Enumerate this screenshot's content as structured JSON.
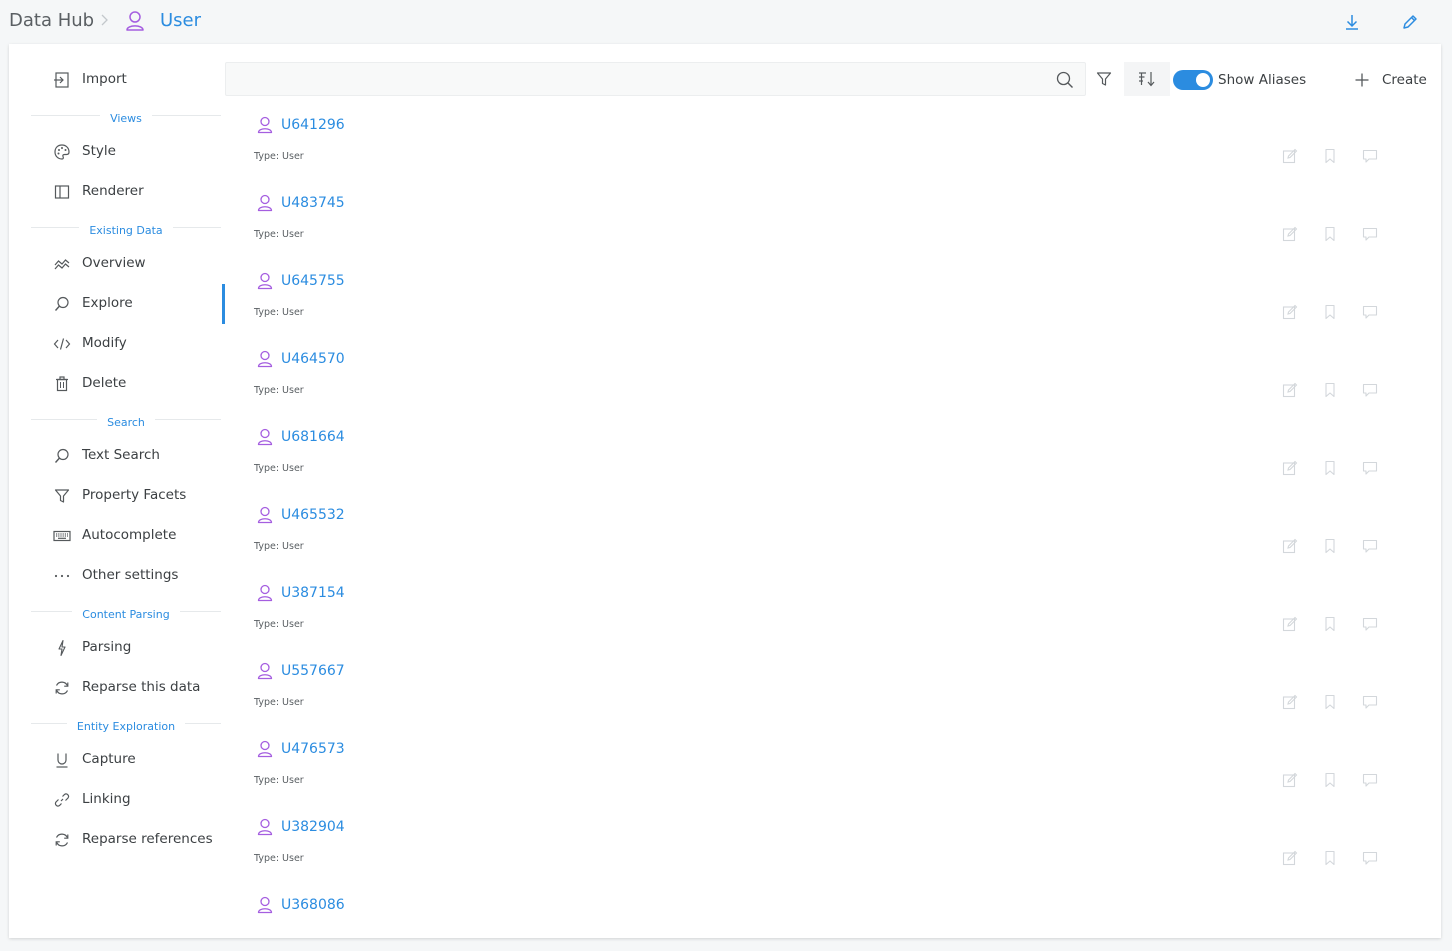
{
  "breadcrumb": {
    "root": "Data Hub",
    "current": "User"
  },
  "colors": {
    "accent": "#2b8ce0",
    "entity_icon": "#a55ee0",
    "muted_icon": "#cfd4d8"
  },
  "sidebar": {
    "items": [
      {
        "label": "Import",
        "icon": "import-icon"
      },
      {
        "section": "Views"
      },
      {
        "label": "Style",
        "icon": "palette-icon"
      },
      {
        "label": "Renderer",
        "icon": "columns-icon"
      },
      {
        "section": "Existing Data"
      },
      {
        "label": "Overview",
        "icon": "overview-icon"
      },
      {
        "label": "Explore",
        "icon": "search-icon",
        "active": true
      },
      {
        "label": "Modify",
        "icon": "code-icon"
      },
      {
        "label": "Delete",
        "icon": "trash-icon"
      },
      {
        "section": "Search"
      },
      {
        "label": "Text Search",
        "icon": "search-icon"
      },
      {
        "label": "Property Facets",
        "icon": "filter-icon"
      },
      {
        "label": "Autocomplete",
        "icon": "keyboard-icon"
      },
      {
        "label": "Other settings",
        "icon": "ellipsis-icon"
      },
      {
        "section": "Content Parsing"
      },
      {
        "label": "Parsing",
        "icon": "bolt-icon"
      },
      {
        "label": "Reparse this data",
        "icon": "refresh-icon"
      },
      {
        "section": "Entity Exploration"
      },
      {
        "label": "Capture",
        "icon": "underline-icon"
      },
      {
        "label": "Linking",
        "icon": "link-icon"
      },
      {
        "label": "Reparse references",
        "icon": "refresh-icon"
      }
    ]
  },
  "toolbar": {
    "search_value": "",
    "show_aliases_label": "Show Aliases",
    "show_aliases_on": true,
    "create_label": "Create"
  },
  "entities": [
    {
      "name": "U641296",
      "type": "Type: User"
    },
    {
      "name": "U483745",
      "type": "Type: User"
    },
    {
      "name": "U645755",
      "type": "Type: User"
    },
    {
      "name": "U464570",
      "type": "Type: User"
    },
    {
      "name": "U681664",
      "type": "Type: User"
    },
    {
      "name": "U465532",
      "type": "Type: User"
    },
    {
      "name": "U387154",
      "type": "Type: User"
    },
    {
      "name": "U557667",
      "type": "Type: User"
    },
    {
      "name": "U476573",
      "type": "Type: User"
    },
    {
      "name": "U382904",
      "type": "Type: User"
    },
    {
      "name": "U368086",
      "type": ""
    }
  ]
}
